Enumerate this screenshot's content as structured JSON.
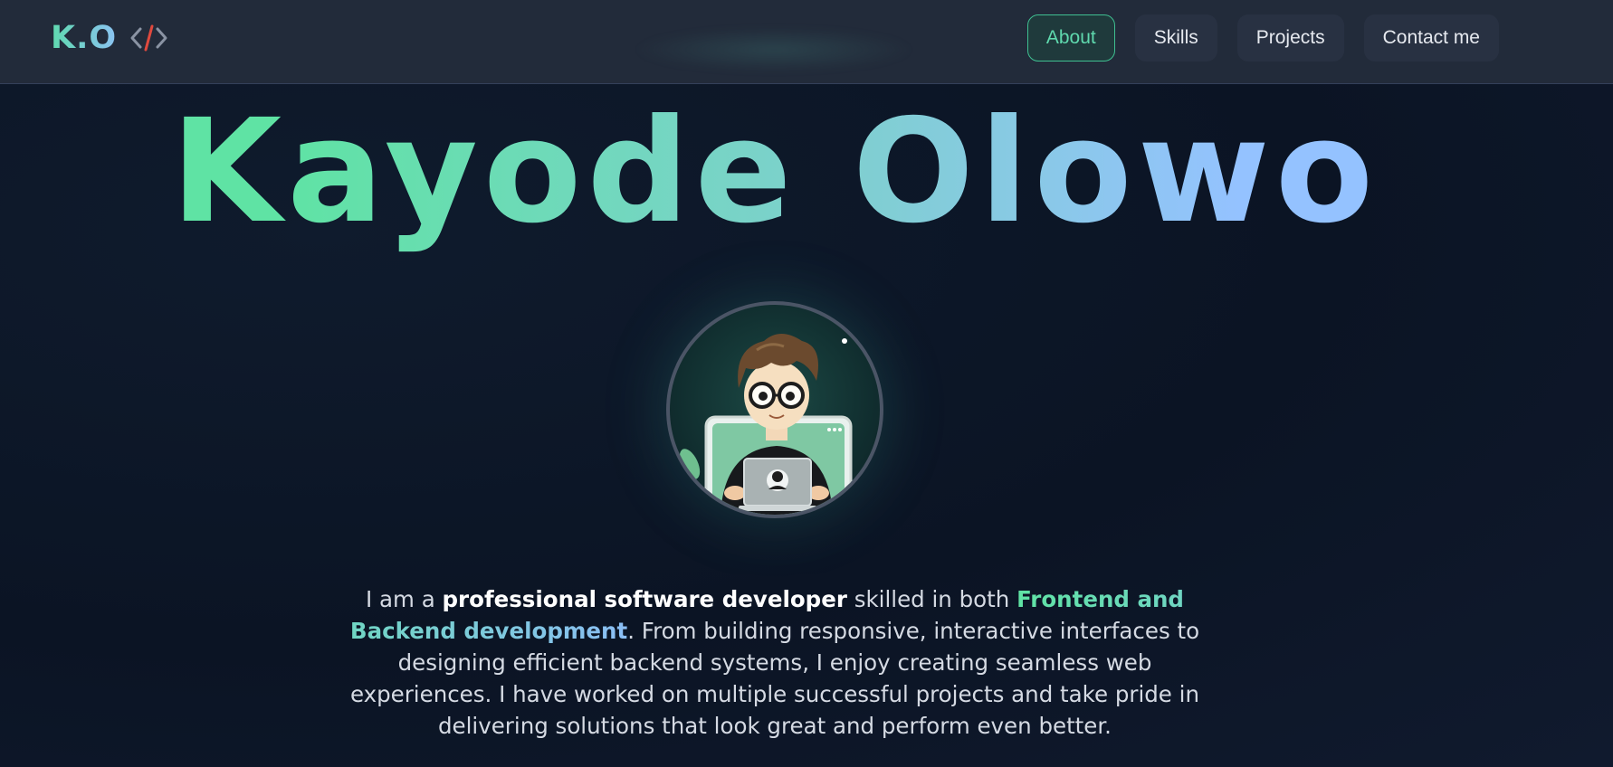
{
  "header": {
    "logo_text": "K.O",
    "logo_icon": "code-icon",
    "nav": [
      {
        "label": "About",
        "active": true
      },
      {
        "label": "Skills",
        "active": false
      },
      {
        "label": "Projects",
        "active": false
      },
      {
        "label": "Contact me",
        "active": false
      }
    ]
  },
  "hero": {
    "name": "Kayode Olowo",
    "avatar_icon": "developer-avatar"
  },
  "bio": {
    "part1": "I am a ",
    "bold": "professional software developer",
    "part2": " skilled in both ",
    "highlight": "Frontend and Backend development",
    "part3": ". From building responsive, interactive interfaces to designing efficient backend systems, I enjoy creating seamless web experiences. I have worked on multiple successful projects and take pride in delivering solutions that look great and perform even better."
  },
  "colors": {
    "accent_green": "#5fd9ae",
    "accent_blue": "#94c2ff",
    "background": "#0b1424",
    "header_bg": "#222b3a"
  }
}
